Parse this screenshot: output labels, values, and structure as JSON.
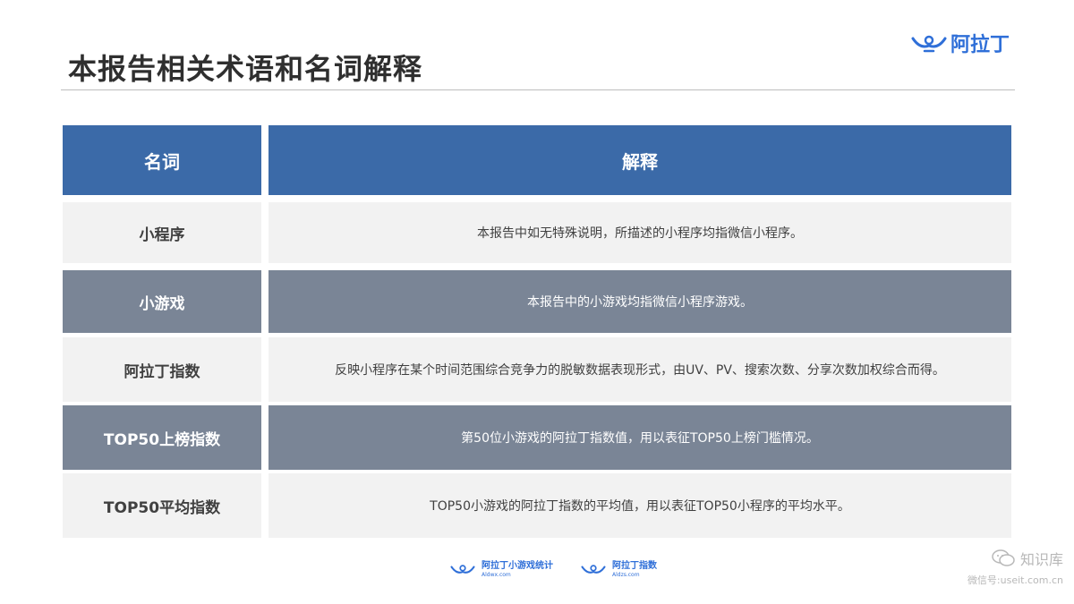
{
  "page": {
    "title": "本报告相关术语和名词解释"
  },
  "logo": {
    "text": "阿拉丁"
  },
  "table": {
    "header": {
      "term": "名词",
      "explanation": "解释"
    },
    "rows": [
      {
        "term": "小程序",
        "explanation": "本报告中如无特殊说明，所描述的小程序均指微信小程序。"
      },
      {
        "term": "小游戏",
        "explanation": "本报告中的小游戏均指微信小程序游戏。"
      },
      {
        "term": "阿拉丁指数",
        "explanation": "反映小程序在某个时间范围综合竞争力的脱敏数据表现形式，由UV、PV、搜索次数、分享次数加权综合而得。"
      },
      {
        "term": "TOP50上榜指数",
        "explanation": "第50位小游戏的阿拉丁指数值，用以表征TOP50上榜门槛情况。"
      },
      {
        "term": "TOP50平均指数",
        "explanation": "TOP50小游戏的阿拉丁指数的平均值，用以表征TOP50小程序的平均水平。"
      }
    ]
  },
  "footer": {
    "logo1_main": "阿拉丁小游戏统计",
    "logo1_sub": "Aldwx.com",
    "logo2_main": "阿拉丁指数",
    "logo2_sub": "Aldzs.com"
  },
  "watermark": {
    "name": "知识库",
    "sub": "微信号:useit.com.cn"
  },
  "colors": {
    "header_bg": "#3b6aa8",
    "row_light": "#f2f2f2",
    "row_dark": "#7a8596",
    "brand_blue": "#2f6fd8"
  }
}
